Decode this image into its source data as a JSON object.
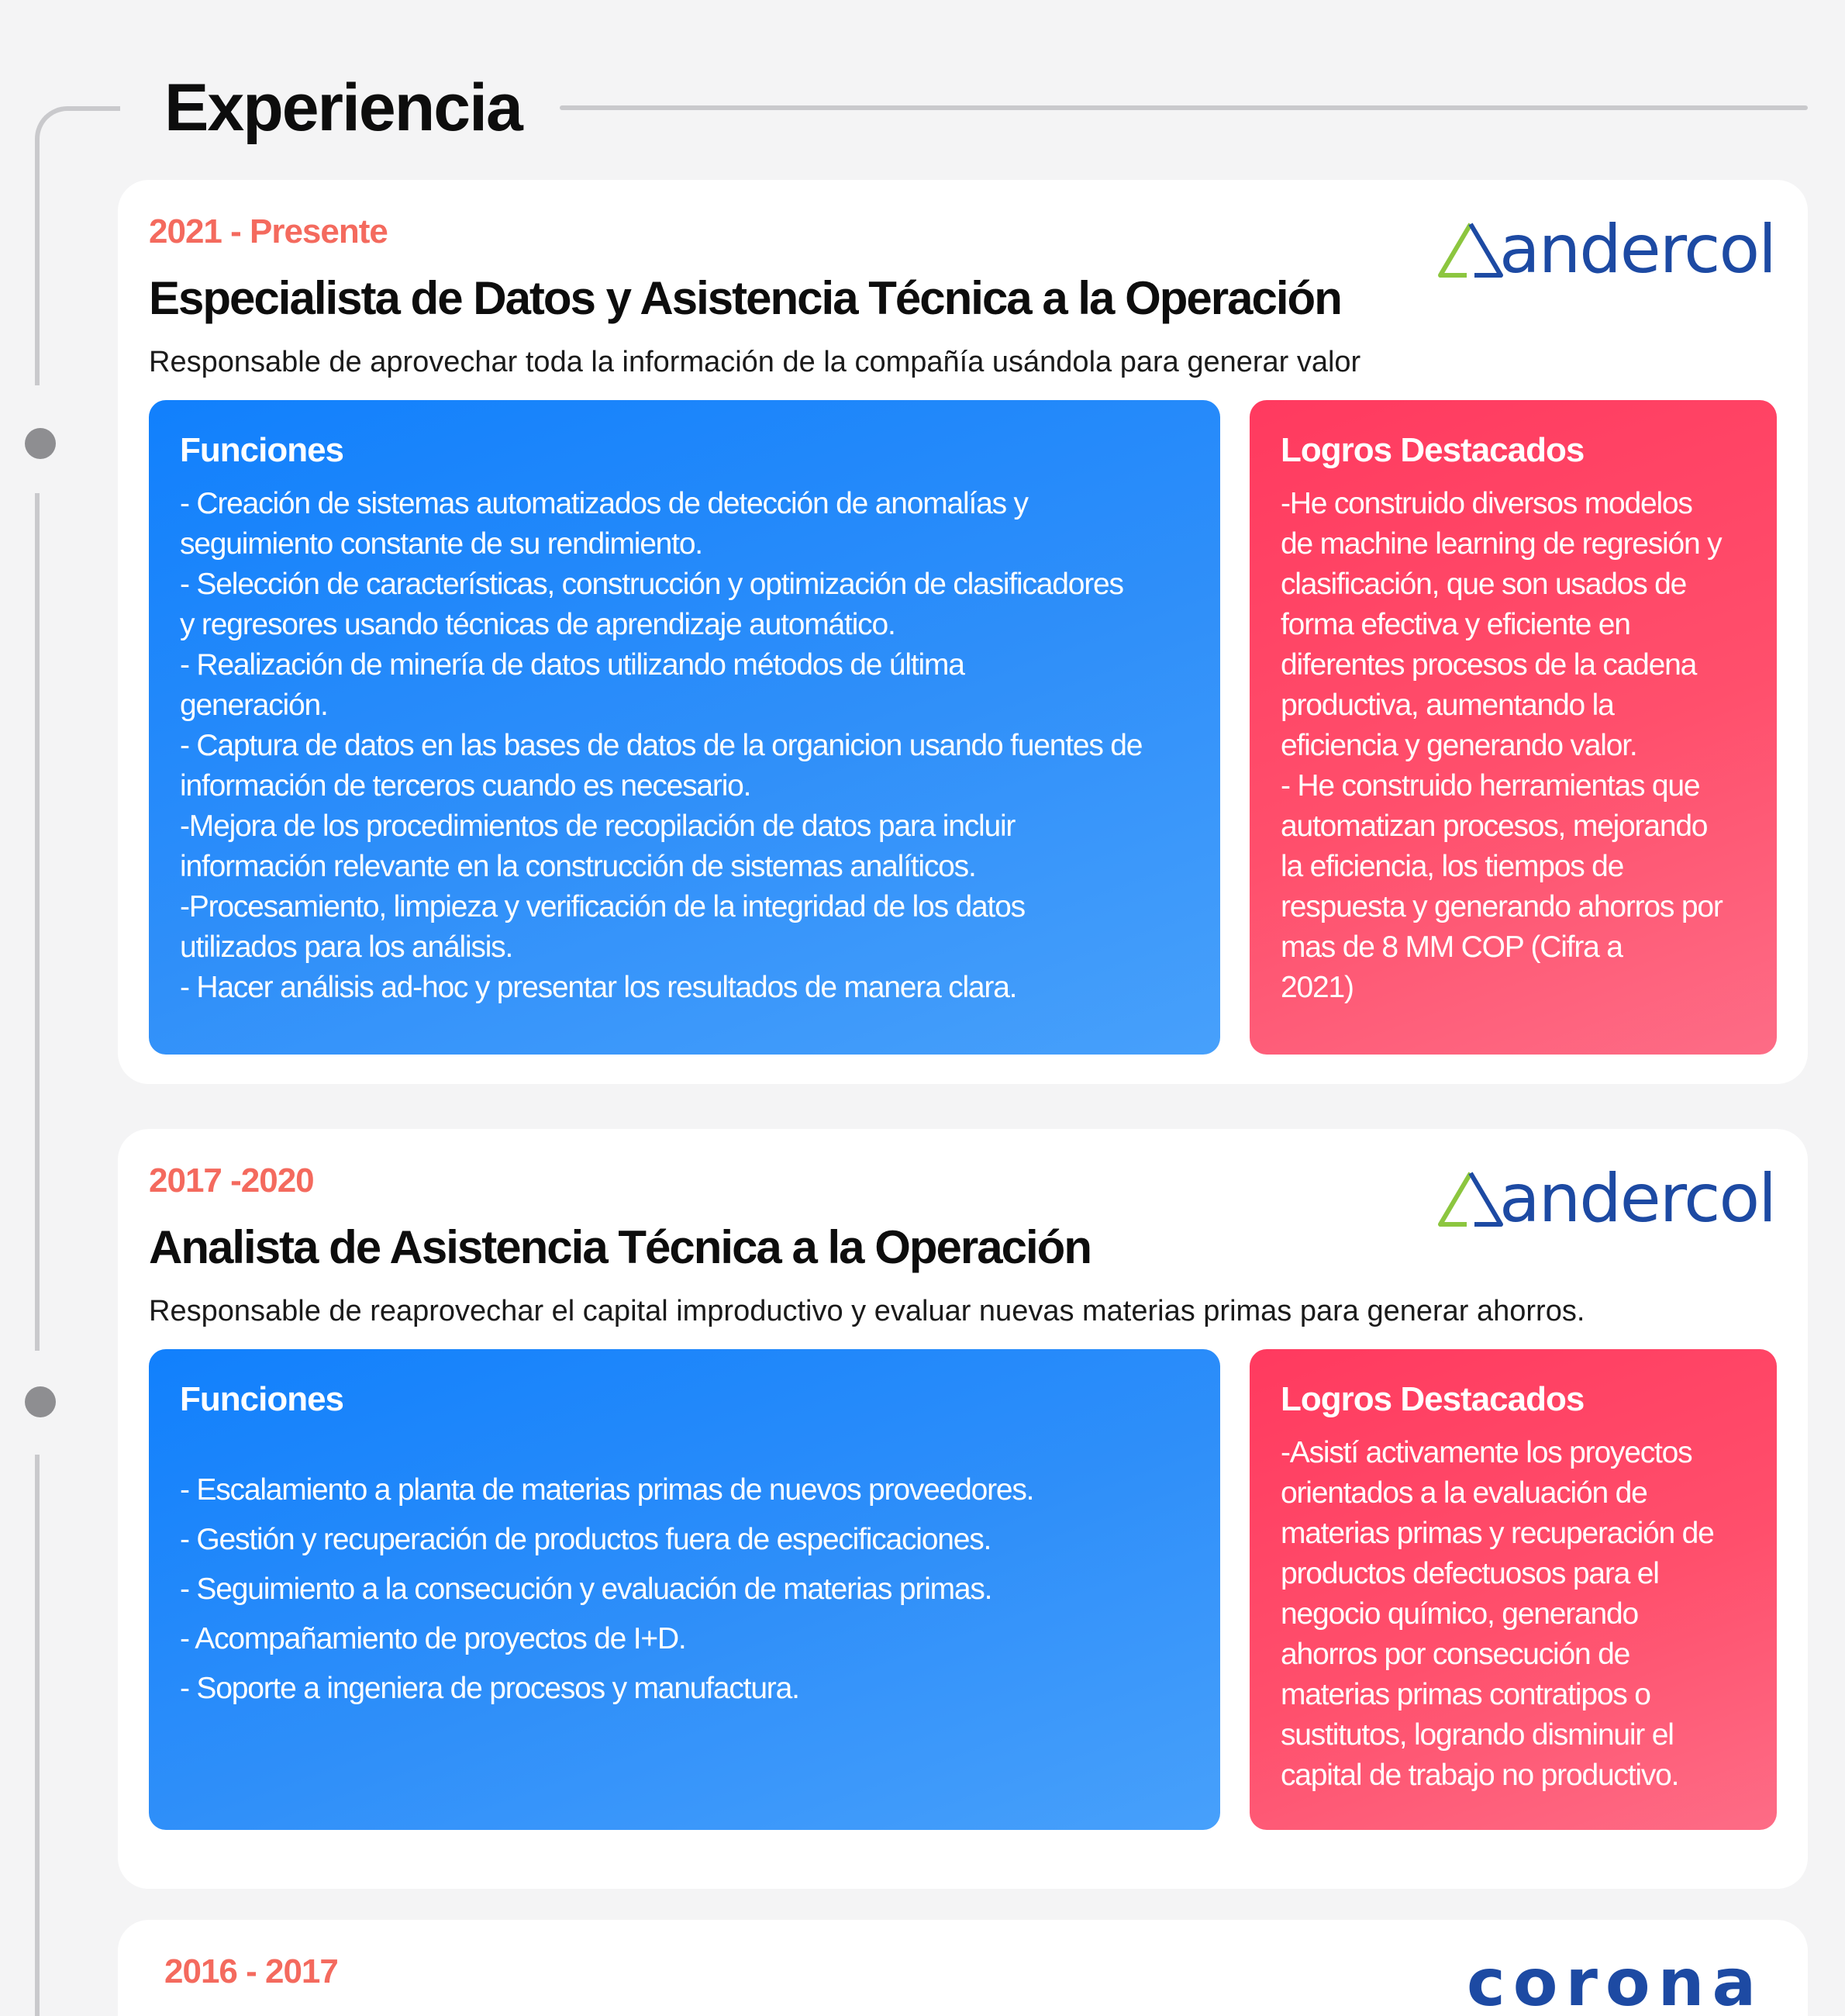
{
  "section": {
    "title": "Experiencia"
  },
  "jobs": [
    {
      "period": "2021 - Presente",
      "company": "andercol",
      "title": "Especialista de Datos y Asistencia Técnica a la Operación",
      "description": "Responsable de aprovechar toda la información de la compañía usándola para generar valor",
      "functions_title": "Funciones",
      "functions_text": "- Creación de sistemas automatizados de detección de anomalías y\nseguimiento constante de su rendimiento.\n- Selección de características, construcción y optimización de clasificadores\ny regresores usando técnicas de aprendizaje automático.\n- Realización de minería de datos utilizando métodos de última\ngeneración.\n- Captura de datos en las bases de datos de la organicion usando fuentes de\ninformación de terceros cuando es necesario.\n-Mejora de los procedimientos de recopilación de datos para incluir\ninformación relevante en  la construcción de sistemas analíticos.\n-Procesamiento, limpieza y verificación  de la integridad de los datos\nutilizados para los análisis.\n- Hacer análisis ad-hoc y presentar los resultados de manera clara.",
      "achievements_title": "Logros Destacados",
      "achievements_text": "-He construido diversos modelos\nde machine learning de regresión y\nclasificación, que son usados de\nforma efectiva y eficiente en\ndiferentes procesos de la cadena\nproductiva, aumentando la\neficiencia y generando valor.\n- He construido herramientas que\nautomatizan procesos, mejorando\nla eficiencia, los tiempos de\nrespuesta y generando ahorros por\nmas de 8 MM COP (Cifra a\n2021)"
    },
    {
      "period": "2017 -2020",
      "company": "andercol",
      "title": "Analista de Asistencia Técnica a la Operación",
      "description": "Responsable de reaprovechar el capital improductivo y evaluar nuevas materias primas para generar ahorros.",
      "functions_title": "Funciones",
      "functions_items": [
        "- Escalamiento a planta de materias primas de nuevos proveedores.",
        "- Gestión y recuperación de productos fuera de especificaciones.",
        "- Seguimiento a la consecución y evaluación de materias primas.",
        "- Acompañamiento de proyectos de I+D.",
        "- Soporte a ingeniera de procesos y manufactura."
      ],
      "achievements_title": "Logros Destacados",
      "achievements_text": "-Asistí activamente los proyectos\norientados a la evaluación de\nmaterias primas y recuperación de\nproductos defectuosos para el\nnegocio químico, generando\nahorros por consecución de\nmaterias primas contratipos o\nsustitutos, logrando disminuir el\ncapital de trabajo no productivo."
    },
    {
      "period": "2016 - 2017",
      "company": "corona"
    }
  ],
  "colors": {
    "period": "#f46a5e",
    "functions_box": "#1180fc",
    "achievements_box": "#ff3a5f",
    "logo_blue": "#1d4aa3",
    "logo_green": "#8cc63f"
  }
}
